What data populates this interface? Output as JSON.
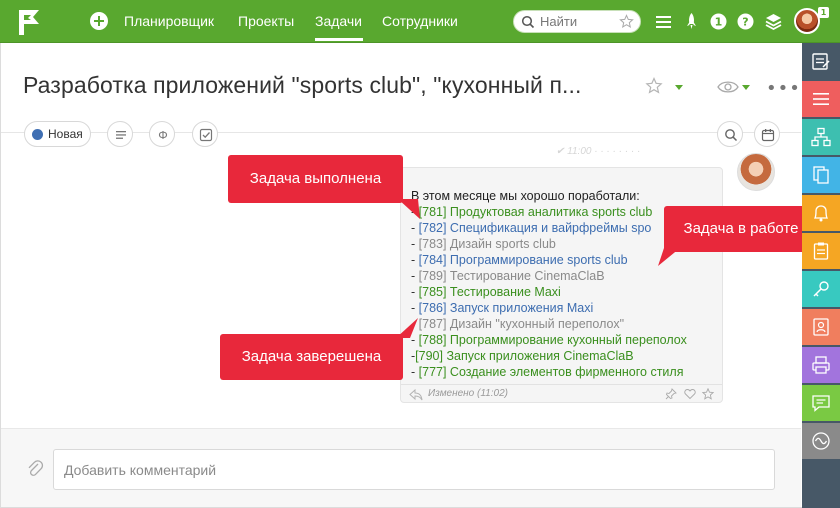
{
  "topbar": {
    "logo_icon": "flag-logo-icon",
    "add_icon": "plus-circle-icon",
    "nav": [
      {
        "label": "Планировщик",
        "active": false
      },
      {
        "label": "Проекты",
        "active": false
      },
      {
        "label": "Задачи",
        "active": true
      },
      {
        "label": "Сотрудники",
        "active": false
      }
    ],
    "search": {
      "placeholder": "Найти"
    },
    "icons": [
      "menu-icon",
      "rocket-icon",
      "info-icon",
      "help-icon",
      "layers-icon"
    ],
    "notification_count": "1",
    "accent_color": "#59a82f"
  },
  "task": {
    "title": "Разработка приложений \"sports club\", \"кухонный п...",
    "status_label": "Новая",
    "status_color": "#3f6fb3"
  },
  "comment": {
    "heading": "В этом месяце мы хорошо поработали:",
    "lines": [
      {
        "prefix": "- ",
        "id": "[781]",
        "text": " Продуктовая аналитика sports club",
        "state": "done"
      },
      {
        "prefix": "- ",
        "id": "[782]",
        "text": " Спецификация и вайрфреймы spo",
        "state": "in_progress"
      },
      {
        "prefix": "- ",
        "id": "[783]",
        "text": " Дизайн sports club",
        "state": "closed"
      },
      {
        "prefix": "- ",
        "id": "[784]",
        "text": " Программирование sports club",
        "state": "in_progress"
      },
      {
        "prefix": "- ",
        "id": "[789]",
        "text": " Тестирование CinemaClaB",
        "state": "closed"
      },
      {
        "prefix": "- ",
        "id": "[785]",
        "text": " Тестирование Maxi",
        "state": "done"
      },
      {
        "prefix": "- ",
        "id": "[786]",
        "text": " Запуск приложения Maxi",
        "state": "in_progress"
      },
      {
        "prefix": "- ",
        "id": "[787]",
        "text": " Дизайн \"кухонный переполох\"",
        "state": "closed"
      },
      {
        "prefix": "- ",
        "id": "[788]",
        "text": " Программирование кухонный переполох",
        "state": "done"
      },
      {
        "prefix": "-",
        "id": "[790]",
        "text": " Запуск приложения CinemaClaB",
        "state": "done"
      },
      {
        "prefix": "- ",
        "id": "[777]",
        "text": " Создание элементов фирменного стиля",
        "state": "done"
      }
    ],
    "footer": "Изменено (11:02)",
    "colors": {
      "done": "#3a8f1e",
      "in_progress": "#3d6db0",
      "closed": "#8a8a8a"
    }
  },
  "callouts": {
    "done": "Задача выполнена",
    "in_progress": "Задача в работе",
    "closed": "Задача заверешена",
    "color": "#e8283b"
  },
  "composer": {
    "placeholder": "Добавить комментарий"
  },
  "right_panel": {
    "buttons": [
      {
        "icon": "edit-note-icon",
        "color": "#475867"
      },
      {
        "icon": "list-icon",
        "color": "#ef5e5e"
      },
      {
        "icon": "hierarchy-icon",
        "color": "#3dbfb0"
      },
      {
        "icon": "documents-icon",
        "color": "#42b4e6"
      },
      {
        "icon": "bell-icon",
        "color": "#f5a623"
      },
      {
        "icon": "clipboard-icon",
        "color": "#f5a623"
      },
      {
        "icon": "key-icon",
        "color": "#38c9c0"
      },
      {
        "icon": "contact-card-icon",
        "color": "#f07e5e"
      },
      {
        "icon": "printer-icon",
        "color": "#a274dd"
      },
      {
        "icon": "chat-icon",
        "color": "#7ac943"
      },
      {
        "icon": "wave-icon",
        "color": "#8a8a8a"
      }
    ]
  }
}
